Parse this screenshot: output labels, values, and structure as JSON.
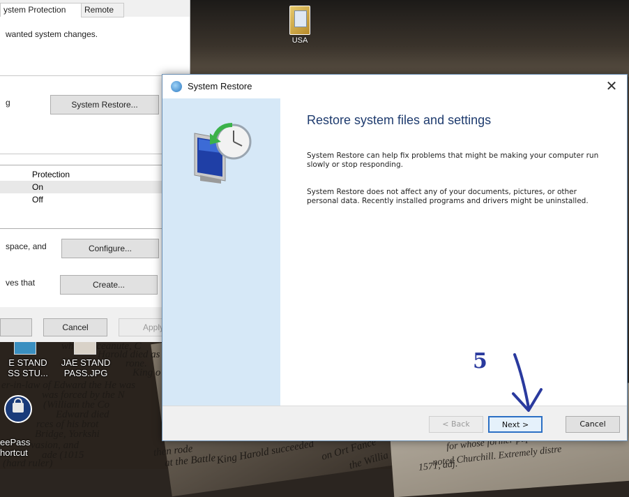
{
  "desktop": {
    "usb_label": "USA",
    "icons": [
      {
        "label_line1": "E STAND",
        "label_line2": "SS STU..."
      },
      {
        "label_line1": "JAE STAND",
        "label_line2": "PASS.JPG"
      },
      {
        "label_line1": "eePass",
        "label_line2": "hortcut"
      }
    ],
    "book_text_left": [
      "while  deceanute, C",
      "Harold  died as Har",
      "rone.",
      "King o",
      "er-in-law of Edward the  He was",
      "was forced by the N",
      "(William the Co",
      "Edward  died",
      "rces of his brot",
      "Bridge, Yorkshi",
      "vasion, and",
      "ade  (1015",
      "(hard ruler)"
    ],
    "book_text_right": [
      "for whose former pupils",
      "noted Churchill.  Extremely distre",
      "1571, adj."
    ],
    "book_text_mid": [
      "then rode",
      "at the Battle",
      "King Harold succeeded",
      "on Ort Fance",
      "the Willia"
    ]
  },
  "properties_dialog": {
    "tab_system_protection": "ystem Protection",
    "tab_remote": "Remote",
    "intro_text": "wanted system changes.",
    "restore_row_text": "g",
    "system_restore_button": "System Restore...",
    "column_protection": "Protection",
    "drives": [
      {
        "protection": "On"
      },
      {
        "protection": "Off"
      }
    ],
    "configure_text": "space, and",
    "configure_button": "Configure...",
    "create_text": "ves that",
    "create_button": "Create...",
    "cancel_button": "Cancel",
    "apply_button": "Apply"
  },
  "restore_window": {
    "title": "System Restore",
    "heading": "Restore system files and settings",
    "para1": "System Restore can help fix problems that might be making your computer run slowly or stop responding.",
    "para2": "System Restore does not affect any of your documents, pictures, or other personal data. Recently installed programs and drivers might be uninstalled.",
    "back_button": "< Back",
    "next_button": "Next >",
    "cancel_button": "Cancel"
  },
  "annotation": {
    "step_number": "5",
    "color": "#2a3a9e"
  },
  "colors": {
    "side_panel": "#d6e8f7",
    "heading": "#1e3b6e",
    "next_border": "#2b6fc4"
  }
}
